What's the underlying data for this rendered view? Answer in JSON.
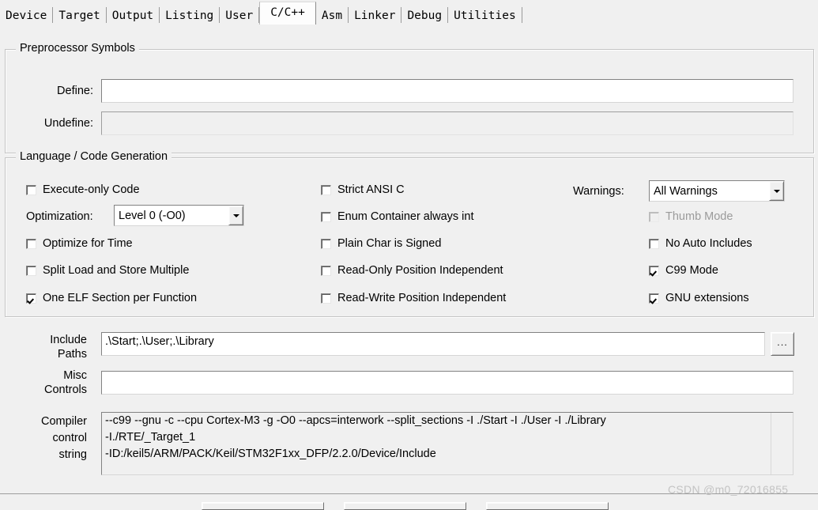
{
  "tabs": {
    "items": [
      {
        "label": "Device",
        "selected": false
      },
      {
        "label": "Target",
        "selected": false
      },
      {
        "label": "Output",
        "selected": false
      },
      {
        "label": "Listing",
        "selected": false
      },
      {
        "label": "User",
        "selected": false
      },
      {
        "label": "C/C++",
        "selected": true
      },
      {
        "label": "Asm",
        "selected": false
      },
      {
        "label": "Linker",
        "selected": false
      },
      {
        "label": "Debug",
        "selected": false
      },
      {
        "label": "Utilities",
        "selected": false
      }
    ]
  },
  "preprocessor": {
    "group_title": "Preprocessor Symbols",
    "define_label": "Define:",
    "define_value": "",
    "define_enabled": true,
    "undefine_label": "Undefine:",
    "undefine_value": "",
    "undefine_enabled": false
  },
  "language": {
    "group_title": "Language / Code Generation",
    "col1": [
      {
        "label": "Execute-only Code",
        "checked": false,
        "enabled": true
      },
      {
        "label": "Optimize for Time",
        "checked": false,
        "enabled": true
      },
      {
        "label": "Split Load and Store Multiple",
        "checked": false,
        "enabled": true
      },
      {
        "label": "One ELF Section per Function",
        "checked": true,
        "enabled": true
      }
    ],
    "col2": [
      {
        "label": "Strict ANSI C",
        "checked": false,
        "enabled": true
      },
      {
        "label": "Enum Container always int",
        "checked": false,
        "enabled": true
      },
      {
        "label": "Plain Char is Signed",
        "checked": false,
        "enabled": true
      },
      {
        "label": "Read-Only Position Independent",
        "checked": false,
        "enabled": true
      },
      {
        "label": "Read-Write Position Independent",
        "checked": false,
        "enabled": true
      }
    ],
    "col3": [
      {
        "label": "Thumb Mode",
        "checked": false,
        "enabled": false
      },
      {
        "label": "No Auto Includes",
        "checked": false,
        "enabled": true
      },
      {
        "label": "C99 Mode",
        "checked": true,
        "enabled": true
      },
      {
        "label": "GNU extensions",
        "checked": true,
        "enabled": true
      }
    ],
    "optimization_label": "Optimization:",
    "optimization_value": "Level 0 (-O0)",
    "warnings_label": "Warnings:",
    "warnings_value": "All Warnings"
  },
  "paths": {
    "include_label_line1": "Include",
    "include_label_line2": "Paths",
    "include_value": ".\\Start;.\\User;.\\Library",
    "browse_label": "...",
    "misc_label_line1": "Misc",
    "misc_label_line2": "Controls",
    "misc_value": ""
  },
  "compiler": {
    "label_line1": "Compiler",
    "label_line2": "control",
    "label_line3": "string",
    "lines": [
      "--c99 --gnu -c --cpu Cortex-M3 -g -O0 --apcs=interwork --split_sections -I ./Start -I ./User -I ./Library",
      "-I./RTE/_Target_1",
      "-ID:/keil5/ARM/PACK/Keil/STM32F1xx_DFP/2.2.0/Device/Include"
    ]
  },
  "watermark": {
    "text": "CSDN @m0_72016855"
  },
  "colors": {
    "dialog_bg": "#f0f0f0",
    "field_bg": "#ffffff",
    "disabled_text": "#9b9b9b",
    "border": "#828282",
    "watermark": "#c3c3c3"
  }
}
